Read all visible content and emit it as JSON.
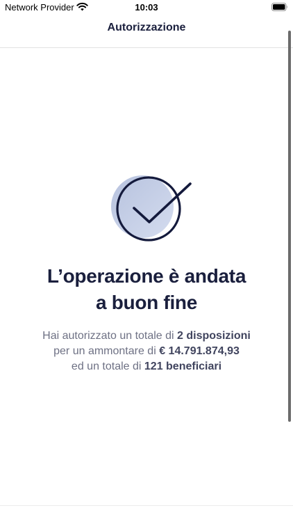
{
  "status_bar": {
    "carrier": "Network Provider",
    "time": "10:03",
    "icons": [
      "wifi-icon",
      "battery-icon"
    ]
  },
  "header": {
    "title": "Autorizzazione"
  },
  "result": {
    "icon": "check-circle-icon",
    "headline_line1": "L’operazione è andata",
    "headline_line2": "a buon fine",
    "line1_prefix": "Hai autorizzato un totale di ",
    "line1_value": "2 disposizioni",
    "line2_prefix": "per un ammontare di ",
    "line2_value": "€ 14.791.874,93",
    "line3_prefix": "ed un totale di ",
    "line3_value": "121 beneficiari"
  },
  "colors": {
    "primary_text": "#1a1f3d",
    "secondary_text": "#6e7184",
    "icon_fill": "#c3cde4"
  }
}
